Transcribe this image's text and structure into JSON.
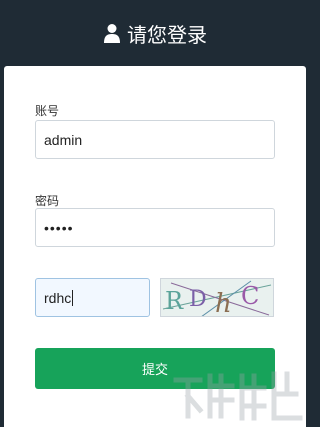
{
  "header": {
    "title": "请您登录",
    "icon": "user-icon"
  },
  "form": {
    "account_label": "账号",
    "account_value": "admin",
    "password_label": "密码",
    "password_value": "•••••",
    "captcha_value": "rdhc",
    "captcha_image_text": "RDhC",
    "submit_label": "提交"
  },
  "colors": {
    "header_bg": "#1f2b35",
    "accent": "#17a35a"
  }
}
